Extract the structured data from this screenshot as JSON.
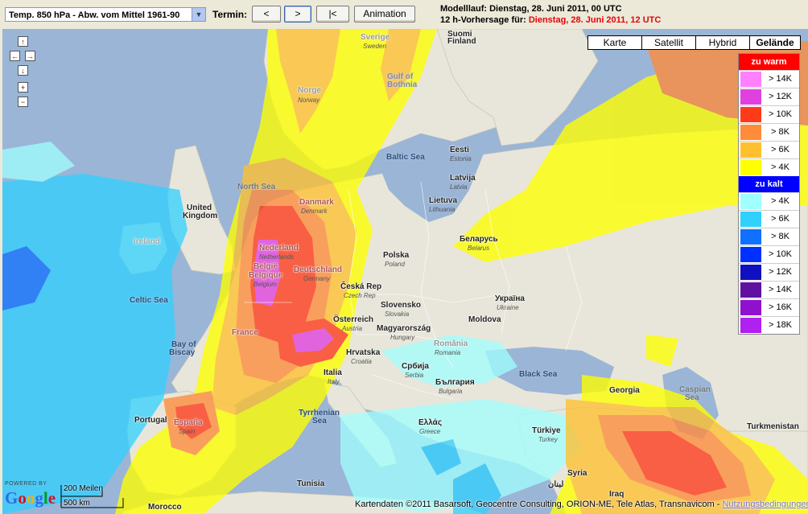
{
  "toolbar": {
    "parameter_select": "Temp. 850 hPa - Abw. vom Mittel 1961-90",
    "termin_label": "Termin:",
    "prev_label": "<",
    "next_label": ">",
    "first_label": "|<",
    "animation_label": "Animation"
  },
  "info": {
    "modelllauf": "Modelllauf: Dienstag, 28. Juni 2011, 00 UTC",
    "vorhersage_prefix": "12 h-Vorhersage für:",
    "vorhersage_date": "Dienstag, 28. Juni 2011, 12 UTC"
  },
  "map_types": [
    "Karte",
    "Satellit",
    "Hybrid",
    "Gelände"
  ],
  "nav": {
    "up": "↑",
    "left": "←",
    "right": "→",
    "down": "↓",
    "zoom_in": "+",
    "zoom_out": "−"
  },
  "legend": {
    "warm_title": "zu warm",
    "cold_title": "zu kalt",
    "warm_color": "#ff0000",
    "cold_color": "#0000ff",
    "warm": [
      {
        "label": "> 14K",
        "color": "#ff80ff"
      },
      {
        "label": "> 12K",
        "color": "#e040e0"
      },
      {
        "label": "> 10K",
        "color": "#ff3a1a"
      },
      {
        "label": "> 8K",
        "color": "#ff8c3a"
      },
      {
        "label": "> 6K",
        "color": "#ffc030"
      },
      {
        "label": "> 4K",
        "color": "#ffff00"
      }
    ],
    "cold": [
      {
        "label": "> 4K",
        "color": "#a0ffff"
      },
      {
        "label": "> 6K",
        "color": "#30d0ff"
      },
      {
        "label": "> 8K",
        "color": "#1070ff"
      },
      {
        "label": "> 10K",
        "color": "#0030ff"
      },
      {
        "label": "> 12K",
        "color": "#1010c0"
      },
      {
        "label": "> 14K",
        "color": "#6010a0"
      },
      {
        "label": "> 16K",
        "color": "#9010d0"
      },
      {
        "label": "> 18K",
        "color": "#b020f0"
      }
    ]
  },
  "countries": {
    "suomi": "Suomi",
    "finland": "Finland",
    "sverige": "Sverige",
    "sweden": "Sweden",
    "norge": "Norge",
    "norway": "Norway",
    "eesti": "Eesti",
    "estonia": "Estonia",
    "latvija": "Latvija",
    "latvia": "Latvia",
    "lietuva": "Lietuva",
    "lithuania": "Lithuania",
    "uk1": "United",
    "uk2": "Kingdom",
    "ireland": "Ireland",
    "danmark": "Danmark",
    "denmark": "Denmark",
    "nederland": "Nederland",
    "netherlands": "Netherlands",
    "belgie": "België",
    "belgique": "Belgique",
    "belgium": "Belgium",
    "deutschland": "Deutschland",
    "germany": "Germany",
    "polska": "Polska",
    "poland": "Poland",
    "belarus_c": "Беларусь",
    "belarus": "Belarus",
    "cesko": "Česká Rep",
    "czech": "Czech Rep",
    "slovensko": "Slovensko",
    "slovakia": "Slovakia",
    "ukraina_c": "Україна",
    "ukraine": "Ukraine",
    "moldova": "Moldova",
    "oesterreich": "Österreich",
    "austria": "Austria",
    "magyar": "Magyarország",
    "hungary": "Hungary",
    "france": "France",
    "romania": "România",
    "romania_en": "Romania",
    "hrvatska": "Hrvatska",
    "croatia": "Croatia",
    "srbija": "Србија",
    "serbia": "Serbia",
    "bulgaria_c": "България",
    "bulgaria": "Bulgaria",
    "italia": "Italia",
    "italy": "Italy",
    "portugal": "Portugal",
    "espana": "España",
    "spain": "Spain",
    "ellas": "Ελλάς",
    "greece": "Greece",
    "turkiye": "Türkiye",
    "turkey": "Turkey",
    "georgia": "Georgia",
    "turkmenistan": "Turkmenistan",
    "syria": "Syria",
    "lebanon": "لبنان",
    "iraq": "Iraq",
    "tunisia": "Tunisia",
    "morocco": "Morocco"
  },
  "seas": {
    "north_sea": "North Sea",
    "baltic_sea": "Baltic Sea",
    "celtic_sea": "Celtic Sea",
    "biscay1": "Bay of",
    "biscay2": "Biscay",
    "black_sea": "Black Sea",
    "caspian1": "Caspian",
    "caspian2": "Sea",
    "tyrrhenian1": "Tyrrhenian",
    "tyrrhenian2": "Sea",
    "bothnia1": "Gulf of",
    "bothnia2": "Bothnia"
  },
  "footer": {
    "powered_by": "POWERED BY",
    "google": "Google",
    "scale_miles": "200 Meilen",
    "scale_km": "500 km",
    "copyright": "Kartendaten ©2011 Basarsoft, Geocentre Consulting, ORION-ME, Tele Atlas, Transnavicom -",
    "terms": "Nutzungsbedingungen"
  }
}
